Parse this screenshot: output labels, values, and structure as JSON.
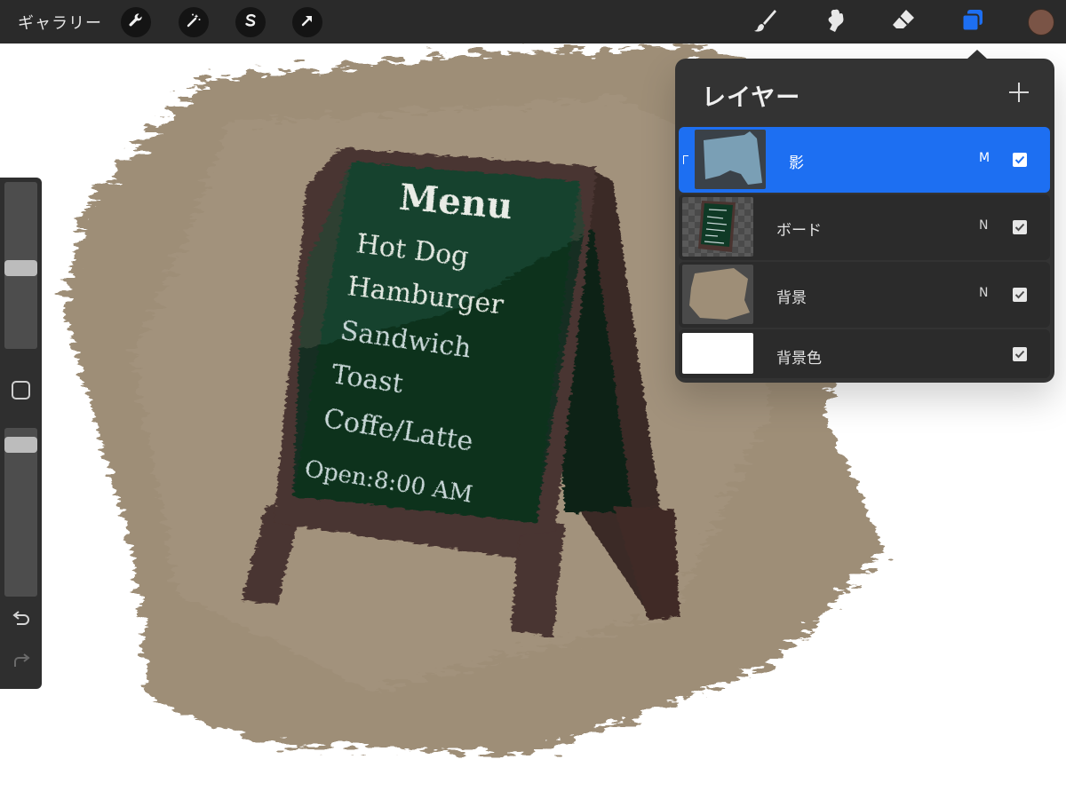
{
  "topbar": {
    "gallery_label": "ギャラリー",
    "left_tools": [
      "wrench-icon",
      "magic-wand-icon",
      "selection-icon",
      "transform-arrow-icon"
    ],
    "right_tools": [
      "brush-icon",
      "smudge-icon",
      "eraser-icon",
      "layers-icon"
    ],
    "active_tool": "layers",
    "accent_color": "#1d6ff2",
    "current_color": "#7a5446"
  },
  "canvas": {
    "sign_lines": [
      "Menu",
      "Hot Dog",
      "Hamburger",
      "Sandwich",
      "Toast",
      "Coffe/Latte",
      "Open:8:00 AM"
    ],
    "background_color": "#9e8e77",
    "board_color": "#0f3a26"
  },
  "sidebar": {
    "brush_size_level": 0.52,
    "opacity_level": 0.06,
    "icons": [
      "modify-square-icon",
      "undo-icon",
      "redo-icon"
    ]
  },
  "layers_panel": {
    "title": "レイヤー",
    "layers": [
      {
        "name": "影",
        "mode": "M",
        "visible": true,
        "active": true,
        "clipped": true
      },
      {
        "name": "ボード",
        "mode": "N",
        "visible": true,
        "active": false,
        "clipped": false
      },
      {
        "name": "背景",
        "mode": "N",
        "visible": true,
        "active": false,
        "clipped": false
      },
      {
        "name": "背景色",
        "mode": "",
        "visible": true,
        "active": false,
        "clipped": false
      }
    ]
  }
}
